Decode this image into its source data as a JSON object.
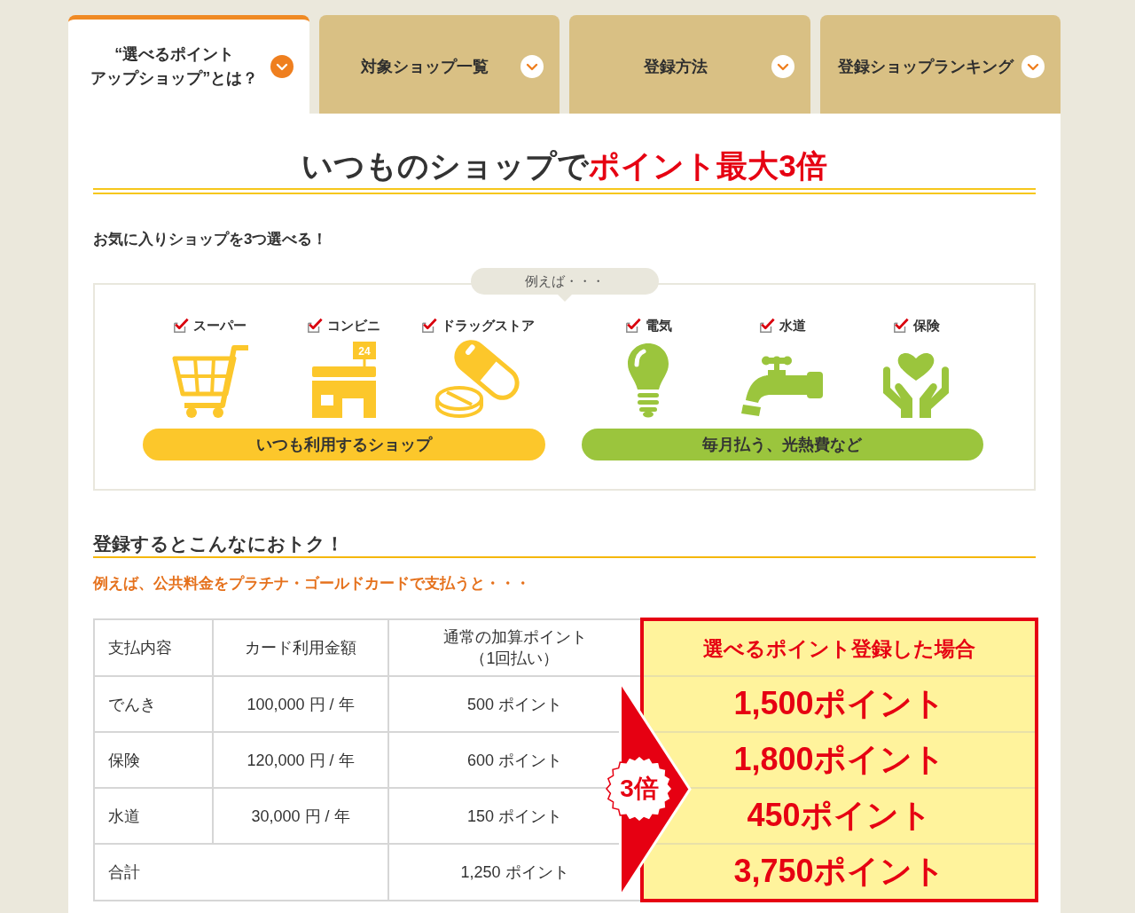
{
  "tabs": [
    {
      "lines": [
        "“選べるポイント",
        "アップショップ”とは？"
      ],
      "selected": true
    },
    {
      "lines": [
        "対象ショップ一覧"
      ],
      "selected": false
    },
    {
      "lines": [
        "登録方法"
      ],
      "selected": false
    },
    {
      "lines": [
        "登録ショップランキング"
      ],
      "selected": false
    }
  ],
  "heading": {
    "text": "いつものショップで",
    "highlight": "ポイント最大3倍"
  },
  "lead": "お気に入りショップを3つ選べる！",
  "examples": {
    "bubble": "例えば・・・",
    "groups": [
      {
        "label": "いつも利用するショップ",
        "color": "#fcc72b",
        "items": [
          {
            "label": "スーパー",
            "checked": true,
            "kind": "cart"
          },
          {
            "label": "コンビニ",
            "checked": true,
            "kind": "store",
            "sign": "24"
          },
          {
            "label": "ドラッグストア",
            "checked": true,
            "kind": "medicine"
          }
        ]
      },
      {
        "label": "毎月払う、光熱費など",
        "color": "#9bc53d",
        "items": [
          {
            "label": "電気",
            "checked": true,
            "kind": "bulb"
          },
          {
            "label": "水道",
            "checked": true,
            "kind": "faucet"
          },
          {
            "label": "保険",
            "checked": true,
            "kind": "care"
          }
        ]
      }
    ]
  },
  "comparison": {
    "title": "登録するとこんなにおトク！",
    "note": "例えば、公共料金をプラチナ・ゴールドカードで支払うと・・・",
    "columns": [
      {
        "label": "支払内容"
      },
      {
        "label": "カード利用金額"
      },
      {
        "label": "通常の加算ポイント",
        "sub": "（1回払い）"
      },
      {
        "label": "選べるポイント登録した場合"
      }
    ],
    "rows": [
      {
        "item": "でんき",
        "amount": "100,000 円 / 年",
        "points": "500 ポイント",
        "boosted": "1,500ポイント"
      },
      {
        "item": "保険",
        "amount": "120,000 円 / 年",
        "points": "600 ポイント",
        "boosted": "1,800ポイント"
      },
      {
        "item": "水道",
        "amount": "30,000 円 / 年",
        "points": "150 ポイント",
        "boosted": "450ポイント"
      },
      {
        "item": "合計",
        "points": "1,250 ポイント",
        "boosted": "3,750ポイント"
      }
    ],
    "multiplier": "3倍"
  }
}
